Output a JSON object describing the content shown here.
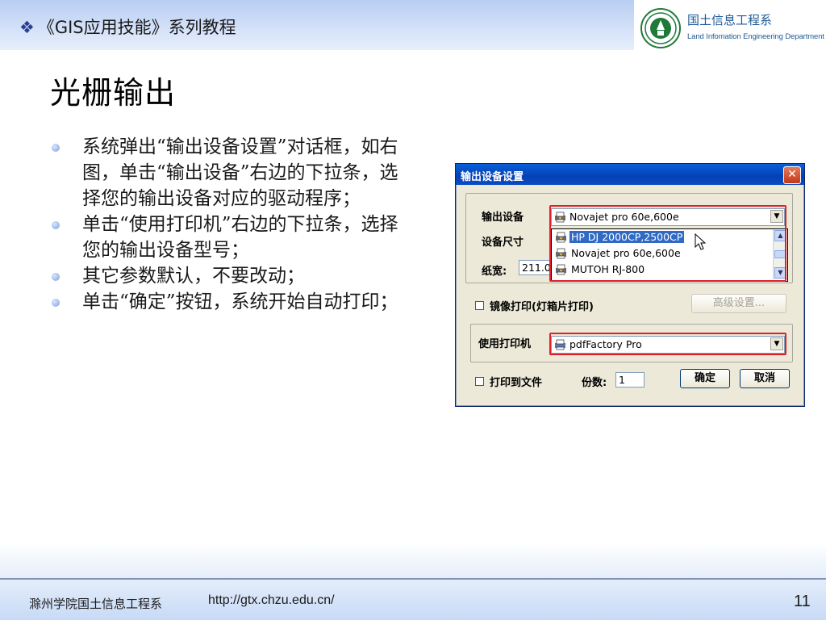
{
  "header": {
    "bullet_glyph": "❖",
    "series_title": "《GIS应用技能》系列教程"
  },
  "logo": {
    "name_cn": "国土信息工程系",
    "name_en": "Land Infomation Engineering Department"
  },
  "slide": {
    "title": "光栅输出",
    "bullets": [
      "系统弹出“输出设备设置”对话框，如右图，单击“输出设备”右边的下拉条，选择您的输出设备对应的驱动程序；",
      "单击“使用打印机”右边的下拉条，选择您的输出设备型号；",
      "其它参数默认，不要改动；",
      "单击“确定”按钮，系统开始自动打印；"
    ]
  },
  "dialog": {
    "title": "输出设备设置",
    "close_glyph": "✕",
    "output_device_label": "输出设备",
    "output_device_value": "Novajet pro 60e,600e",
    "paper_size_label": "设备尺寸",
    "paper_width_label": "纸宽:",
    "paper_width_value": "211.0",
    "dropdown_options": [
      {
        "label": "HP DJ 2000CP,2500CP",
        "selected": true
      },
      {
        "label": "Novajet pro 60e,600e",
        "selected": false
      },
      {
        "label": "MUTOH RJ-800",
        "selected": false
      }
    ],
    "mirror_print_label": "镜像打印(灯箱片打印)",
    "advanced_button": "高级设置...",
    "use_printer_label": "使用打印机",
    "printer_value": "pdfFactory Pro",
    "print_to_file_label": "打印到文件",
    "copies_label": "份数:",
    "copies_value": "1",
    "ok_button": "确定",
    "cancel_button": "取消"
  },
  "footer": {
    "org": "滁州学院国土信息工程系",
    "url": "http://gtx.chzu.edu.cn/",
    "page_number": "11"
  },
  "colors": {
    "header_band": "#b9cef3",
    "title_bar": "#0441b4",
    "highlight": "#316ac5",
    "callout_red": "#e0202a",
    "logo_green": "#1f7a3a"
  }
}
